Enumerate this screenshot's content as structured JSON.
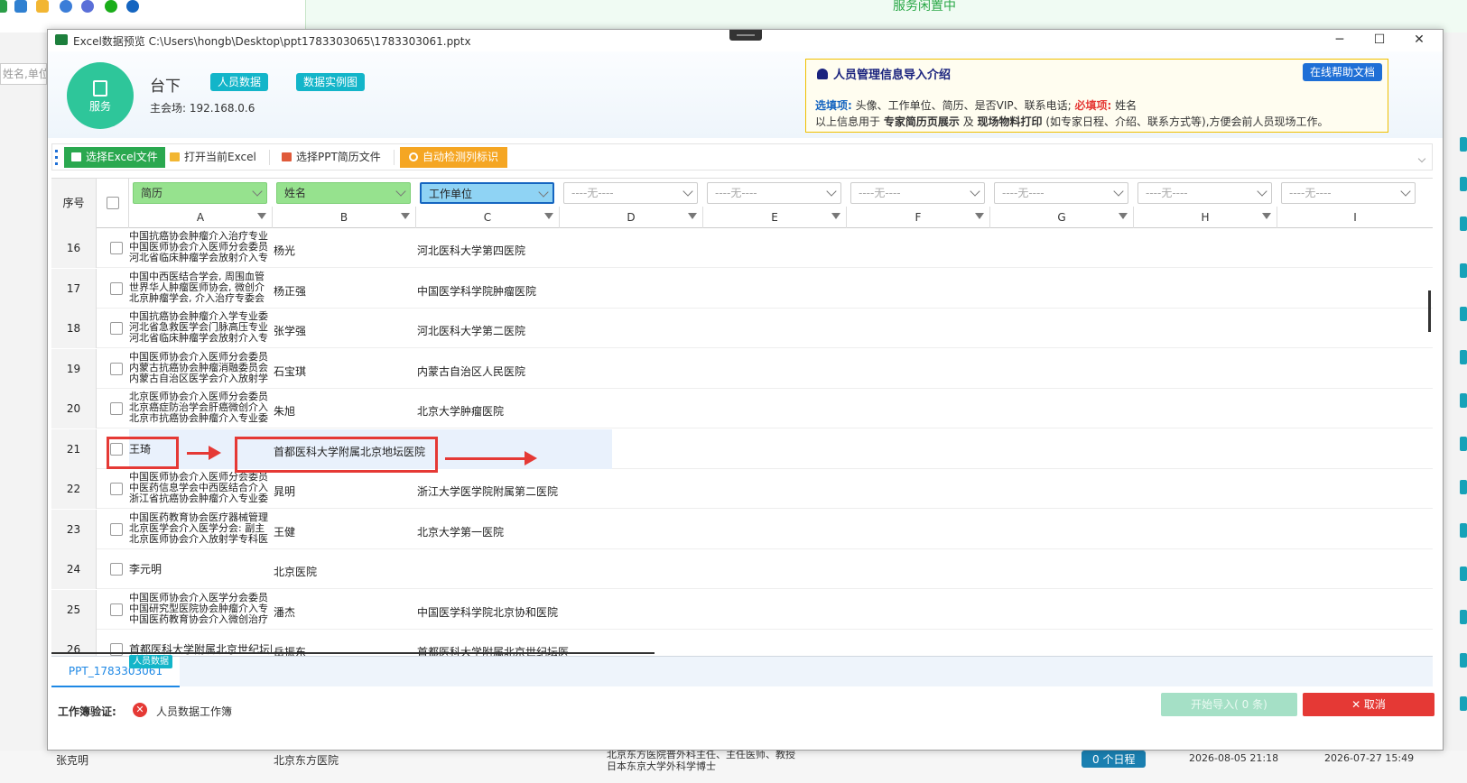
{
  "background": {
    "status_text": "服务闲置中",
    "search_placeholder": "姓名,单位",
    "bottom_row": {
      "name": "张克明",
      "unit": "北京东方医院",
      "resume_line1": "北京东方医院普外科主任、主任医师、教授",
      "resume_line2": "日本东京大学外科学博士",
      "schedule": "0 个日程",
      "time1": "2026-08-05 21:18",
      "time2": "2026-07-27 15:49"
    }
  },
  "window": {
    "title": "Excel数据预览 C:\\Users\\hongb\\Desktop\\ppt1783303065\\1783303061.pptx",
    "minimize": "─",
    "maximize": "☐",
    "close": "✕"
  },
  "header": {
    "logo_label": "服务",
    "name": "台下",
    "sub": "主会场: 192.168.0.6",
    "tag_people": "人员数据",
    "tag_example": "数据实例图"
  },
  "intro": {
    "title": "人员管理信息导入介绍",
    "help": "在线帮助文档",
    "optional_label": "选填项:",
    "optional_text": "头像、工作单位、简历、是否VIP、联系电话;",
    "required_label": "必填项:",
    "required_text": "姓名",
    "line2_a": "以上信息用于",
    "line2_b": "专家简历页展示",
    "line2_c": "及",
    "line2_d": "现场物料打印",
    "line2_e": "(如专家日程、介绍、联系方式等),方便会前人员现场工作。"
  },
  "toolbar": {
    "select_excel": "选择Excel文件",
    "open_excel": "打开当前Excel",
    "select_ppt": "选择PPT简历文件",
    "auto_detect": "自动检测列标识"
  },
  "grid": {
    "seq_header": "序号",
    "col_selects": [
      "简历",
      "姓名",
      "工作单位",
      "----无----",
      "----无----",
      "----无----",
      "----无----",
      "----无----",
      "----无----"
    ],
    "col_letters": [
      "A",
      "B",
      "C",
      "D",
      "E",
      "F",
      "G",
      "H",
      "I"
    ],
    "rows": [
      {
        "n": "16",
        "resume": [
          "中国抗癌协会肿瘤介入治疗专业",
          "中国医师协会介入医师分会委员",
          "河北省临床肿瘤学会放射介入专"
        ],
        "name": "杨光",
        "unit": "河北医科大学第四医院"
      },
      {
        "n": "17",
        "resume": [
          "中国中西医结合学会, 周围血管",
          "世界华人肿瘤医师协会, 微创介",
          "北京肿瘤学会, 介入治疗专委会"
        ],
        "name": "杨正强",
        "unit": "中国医学科学院肿瘤医院"
      },
      {
        "n": "18",
        "resume": [
          "中国抗癌协会肿瘤介入学专业委",
          "河北省急救医学会门脉高压专业",
          "河北省临床肿瘤学会放射介入专"
        ],
        "name": "张学强",
        "unit": "河北医科大学第二医院"
      },
      {
        "n": "19",
        "resume": [
          "中国医师协会介入医师分会委员",
          "内蒙古抗癌协会肿瘤消融委员会",
          "内蒙古自治区医学会介入放射学"
        ],
        "name": "石宝琪",
        "unit": "内蒙古自治区人民医院"
      },
      {
        "n": "20",
        "resume": [
          "北京医师协会介入医师分会委员",
          "北京癌症防治学会肝癌微创介入",
          "北京市抗癌协会肿瘤介入专业委"
        ],
        "name": "朱旭",
        "unit": "北京大学肿瘤医院"
      },
      {
        "n": "21",
        "resume": [
          "王琦"
        ],
        "name": "首都医科大学附属北京地坛医院",
        "unit": ""
      },
      {
        "n": "22",
        "resume": [
          "中国医师协会介入医师分会委员",
          "中医药信息学会中西医结合介入",
          "浙江省抗癌协会肿瘤介入专业委"
        ],
        "name": "晁明",
        "unit": "浙江大学医学院附属第二医院"
      },
      {
        "n": "23",
        "resume": [
          "中国医药教育协会医疗器械管理",
          "北京医学会介入医学分会: 副主",
          "北京医师协会介入放射学专科医"
        ],
        "name": "王健",
        "unit": "北京大学第一医院"
      },
      {
        "n": "24",
        "resume": [
          "李元明"
        ],
        "name": "北京医院",
        "unit": ""
      },
      {
        "n": "25",
        "resume": [
          "中国医师协会介入医学分会委员",
          "中国研究型医院协会肿瘤介入专",
          "中国医药教育协会介入微创治疗"
        ],
        "name": "潘杰",
        "unit": "中国医学科学院北京协和医院"
      },
      {
        "n": "26",
        "resume": [
          "首都医科大学附属北京世纪坛医"
        ],
        "name": "岳振东",
        "unit": "首都医科大学附属北京世纪坛医"
      }
    ]
  },
  "sheets": {
    "tab": "PPT_1783303061",
    "badge": "人员数据"
  },
  "footer": {
    "label": "工作簿验证:",
    "error_icon": "✕",
    "workbook": "人员数据工作簿",
    "import": "开始导入( 0 条)",
    "cancel": "✕ 取消"
  },
  "colors": {
    "accent_green": "#2ec69a",
    "tag_teal": "#13b5c9",
    "danger": "#e53935",
    "primary": "#1e6fd6"
  }
}
